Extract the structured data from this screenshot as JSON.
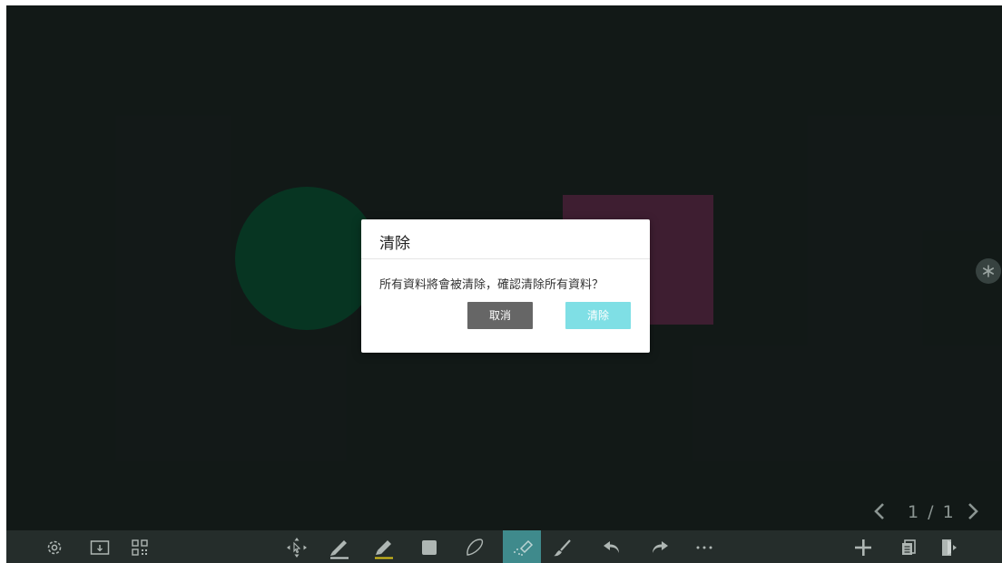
{
  "canvas": {
    "background": "#1a2321",
    "shapes": [
      {
        "kind": "circle",
        "color": "#0b4a30"
      },
      {
        "kind": "rectangle",
        "color": "#562a45"
      }
    ]
  },
  "dialog": {
    "title": "清除",
    "message": "所有資料將會被清除，確認清除所有資料？",
    "cancel_label": "取消",
    "confirm_label": "清除",
    "cancel_color": "#666666",
    "confirm_color": "#7fdfe5"
  },
  "pager": {
    "prev_icon": "chevron-left-icon",
    "page_text": "1 / 1",
    "next_icon": "chevron-right-icon"
  },
  "side": {
    "icon": "asterisk-icon"
  },
  "toolbar": {
    "left_tools": [
      "gear-icon",
      "folder-download-icon",
      "qr-code-icon"
    ],
    "center_tools": [
      "select-move-icon",
      "pen-icon",
      "highlighter-icon",
      "shape-square-icon",
      "lasso-icon",
      "eraser-icon",
      "brush-clear-icon",
      "undo-icon",
      "redo-icon",
      "more-icon"
    ],
    "right_tools": [
      "add-page-icon",
      "pages-icon",
      "exit-icon"
    ],
    "active_tool": "eraser-icon",
    "active_color": "#3f8a8c",
    "pen_underline_color": "#c8d0ce",
    "highlighter_underline_color": "#d9c21a"
  }
}
